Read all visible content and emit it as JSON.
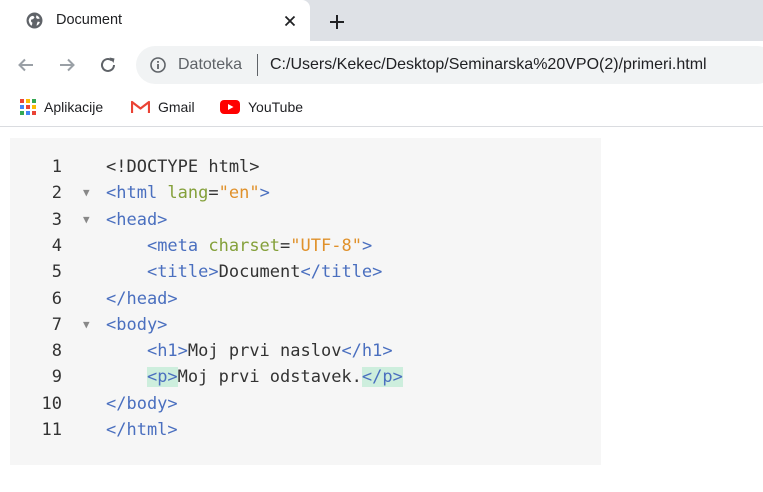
{
  "tab": {
    "title": "Document"
  },
  "toolbar": {
    "chip_label": "Datoteka",
    "url": "C:/Users/Kekec/Desktop/Seminarska%20VPO(2)/primeri.html"
  },
  "bookmarks": [
    {
      "label": "Aplikacije",
      "icon": "apps-grid-icon"
    },
    {
      "label": "Gmail",
      "icon": "gmail-icon"
    },
    {
      "label": "YouTube",
      "icon": "youtube-icon"
    }
  ],
  "code": {
    "line_numbers": [
      "1",
      "2",
      "3",
      "4",
      "5",
      "6",
      "7",
      "8",
      "9",
      "10",
      "11"
    ],
    "lines": [
      [
        {
          "t": "<!DOCTYPE html>",
          "c": "x"
        }
      ],
      [
        {
          "t": "<html",
          "c": "t"
        },
        {
          "t": " lang",
          "c": "a"
        },
        {
          "t": "=",
          "c": "x"
        },
        {
          "t": "\"en\"",
          "c": "v"
        },
        {
          "t": ">",
          "c": "t"
        }
      ],
      [
        {
          "t": "<head>",
          "c": "t"
        }
      ],
      [
        {
          "t": "    ",
          "c": "x"
        },
        {
          "t": "<meta",
          "c": "t"
        },
        {
          "t": " charset",
          "c": "a"
        },
        {
          "t": "=",
          "c": "x"
        },
        {
          "t": "\"UTF-8\"",
          "c": "v"
        },
        {
          "t": ">",
          "c": "t"
        }
      ],
      [
        {
          "t": "    ",
          "c": "x"
        },
        {
          "t": "<title>",
          "c": "t"
        },
        {
          "t": "Document",
          "c": "x"
        },
        {
          "t": "</title>",
          "c": "t"
        }
      ],
      [
        {
          "t": "</head>",
          "c": "t"
        }
      ],
      [
        {
          "t": "<body>",
          "c": "t"
        }
      ],
      [
        {
          "t": "    ",
          "c": "x"
        },
        {
          "t": "<h1>",
          "c": "t"
        },
        {
          "t": "Moj prvi naslov",
          "c": "x"
        },
        {
          "t": "</h1>",
          "c": "t"
        }
      ],
      [
        {
          "t": "    ",
          "c": "x"
        },
        {
          "t": "<p>",
          "c": "t hl"
        },
        {
          "t": "Moj prvi odstavek.",
          "c": "x"
        },
        {
          "t": "</p>",
          "c": "t hl"
        }
      ],
      [
        {
          "t": "</body>",
          "c": "t"
        }
      ],
      [
        {
          "t": "</html>",
          "c": "t"
        }
      ]
    ],
    "folds": [
      false,
      true,
      true,
      false,
      false,
      false,
      true,
      false,
      false,
      false,
      false
    ]
  },
  "colors": {
    "tag": "#4a6fbf",
    "attribute": "#84a03a",
    "value": "#e0912b",
    "highlight": "#cdeedd",
    "code_bg": "#f6f6f6"
  }
}
